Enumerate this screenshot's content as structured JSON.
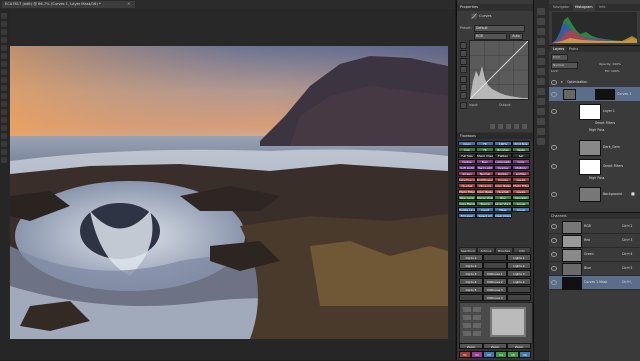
{
  "document_tab": {
    "title": "ECA7617 (edit) @ 66.7% (Curves 1, Layer Mask/16) *",
    "close": "×"
  },
  "properties": {
    "panel_title": "Properties",
    "adjustment": "Curves",
    "preset_label": "Preset:",
    "preset_value": "Default",
    "channel_value": "RGB",
    "auto_label": "Auto",
    "input_label": "Input:",
    "output_label": "Output:"
  },
  "actions_panel": {
    "title": "Flowtools",
    "buttons": [
      {
        "label": "Open",
        "color": "#4a70a8"
      },
      {
        "label": "Fit",
        "color": "#4a70a8"
      },
      {
        "label": "100%",
        "color": "#4a70a8"
      },
      {
        "label": "Print Size",
        "color": "#4a70a8"
      },
      {
        "label": "Cop",
        "color": "#3e7a45"
      },
      {
        "label": "Fit",
        "color": "#3e7a45"
      },
      {
        "label": "Brushes",
        "color": "#3e7a45"
      },
      {
        "label": "Paste",
        "color": "#3e7a45"
      },
      {
        "label": "Full Size",
        "color": "#303030"
      },
      {
        "label": "Sharp Image",
        "color": "#303030"
      },
      {
        "label": "Flatten",
        "color": "#303030"
      },
      {
        "label": "Sat",
        "color": "#303030"
      },
      {
        "label": "Dodge",
        "color": "#8a3a8a"
      },
      {
        "label": "Burn",
        "color": "#8a3a8a"
      },
      {
        "label": "Luminosity",
        "color": "#8a3a8a"
      },
      {
        "label": "Color",
        "color": "#8a3a8a"
      },
      {
        "label": "Soft Light",
        "color": "#7a3a9a"
      },
      {
        "label": "Hard Light",
        "color": "#7a3a9a"
      },
      {
        "label": "Overlay",
        "color": "#7a3a9a"
      },
      {
        "label": "Multiply",
        "color": "#7a3a9a"
      },
      {
        "label": "Screen",
        "color": "#9a3a5a"
      },
      {
        "label": "Normal",
        "color": "#9a3a5a"
      },
      {
        "label": "Darken",
        "color": "#9a3a5a"
      },
      {
        "label": "Lighten",
        "color": "#9a3a5a"
      },
      {
        "label": "Selective Color",
        "color": "#a33a3a"
      },
      {
        "label": "Brightness/Contrast",
        "color": "#a33a3a"
      },
      {
        "label": "Curves",
        "color": "#a33a3a"
      },
      {
        "label": "Levels",
        "color": "#a33a3a"
      },
      {
        "label": "Hue/Sat",
        "color": "#a83a3a"
      },
      {
        "label": "Vibrance",
        "color": "#a83a3a"
      },
      {
        "label": "Color Balance",
        "color": "#a83a3a"
      },
      {
        "label": "Photo Filter",
        "color": "#a83a3a"
      },
      {
        "label": "Photo Filter",
        "color": "#b04848"
      },
      {
        "label": "Color Balance",
        "color": "#b04848"
      },
      {
        "label": "Hue/Sat",
        "color": "#b04848"
      },
      {
        "label": "Levels",
        "color": "#b04848"
      },
      {
        "label": "New Layer",
        "color": "#3f8a45"
      },
      {
        "label": "Merge Visible",
        "color": "#3f8a45"
      },
      {
        "label": "Blur",
        "color": "#3f8a45"
      },
      {
        "label": "Gaussian",
        "color": "#3f8a45"
      },
      {
        "label": "Copy Merged",
        "color": "#3f8a45"
      },
      {
        "label": "Stamp",
        "color": "#3f8a45"
      },
      {
        "label": "Layer Via Copy",
        "color": "#3f8a45"
      },
      {
        "label": "Group",
        "color": "#3f8a45"
      },
      {
        "label": "Delete Layer",
        "color": "#3a7ab0"
      },
      {
        "label": "Invert",
        "color": "#3a7ab0"
      },
      {
        "label": "Mask",
        "color": "#3a7ab0"
      },
      {
        "label": "Group",
        "color": "#3a7ab0"
      },
      {
        "label": "Fill Layer",
        "color": "#3a7ab0"
      },
      {
        "label": "Select All",
        "color": "#3a7ab0"
      },
      {
        "label": "Clear Channels",
        "color": "#3a7ab0"
      }
    ],
    "tabs": [
      "Spectrum",
      "Actions",
      "Brushes",
      "Info"
    ],
    "grid_rows": [
      [
        "Darks 1",
        "",
        "Lights 1"
      ],
      [
        "Darks 2",
        "",
        "Lights 2"
      ],
      [
        "Darks 3",
        "Midtones 1",
        "Lights 3"
      ],
      [
        "Darks 4",
        "Midtones 2",
        "Lights 4"
      ],
      [
        "Darks 5",
        "Midtones 3",
        ""
      ],
      [
        "",
        "Midtones 4",
        ""
      ]
    ],
    "bottom_labels": [
      "Zoom",
      "Zoom",
      "Zoom"
    ],
    "footer_buttons": [
      "V1",
      "V2",
      "V3",
      "V4",
      "V5",
      "V6"
    ]
  },
  "histogram_panel": {
    "tabs": [
      "Navigator",
      "Histogram",
      "Info"
    ]
  },
  "layers_panel": {
    "tabs": [
      "Layers",
      "Paths"
    ],
    "kind_label": "Kind",
    "blend_mode": "Normal",
    "opacity_label": "Opacity: 100%",
    "lock_label": "Lock:",
    "fill_label": "Fill: 100%",
    "rows": [
      {
        "name": "Optimization",
        "type": "group"
      },
      {
        "name": "Curves 1",
        "type": "adjustment"
      },
      {
        "name": "Layer 1",
        "type": "layer"
      },
      {
        "name": "Smart Filters",
        "type": "sub"
      },
      {
        "name": "High Pass",
        "type": "sub"
      },
      {
        "name": "Dark_Gem",
        "type": "layer"
      },
      {
        "name": "Smart Filters",
        "type": "sub"
      },
      {
        "name": "High Pass",
        "type": "sub"
      },
      {
        "name": "Background",
        "type": "layer"
      }
    ]
  },
  "channels_panel": {
    "tab": "Channels",
    "rows": [
      {
        "name": "RGB",
        "shortcut": "Ctrl+2"
      },
      {
        "name": "Red",
        "shortcut": "Ctrl+3"
      },
      {
        "name": "Green",
        "shortcut": "Ctrl+4"
      },
      {
        "name": "Blue",
        "shortcut": "Ctrl+5"
      },
      {
        "name": "Curves 1 Mask",
        "shortcut": "Ctrl+\\"
      }
    ]
  },
  "colors": {
    "ui_bg": "#1e1e1e",
    "panel_bg": "#3a3a3a"
  }
}
